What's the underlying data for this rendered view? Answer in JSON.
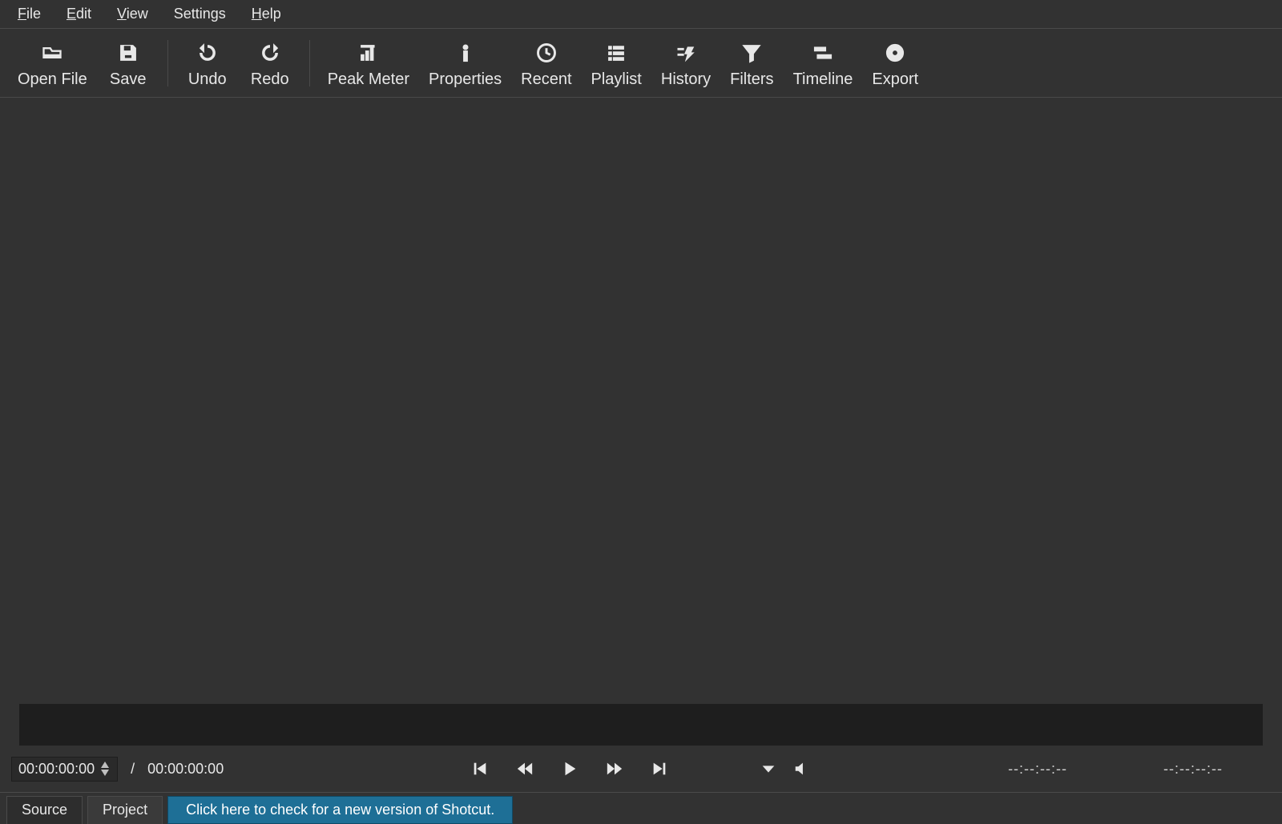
{
  "menubar": {
    "file": "File",
    "edit": "Edit",
    "view": "View",
    "settings": "Settings",
    "help": "Help"
  },
  "toolbar": {
    "open_file": "Open File",
    "save": "Save",
    "undo": "Undo",
    "redo": "Redo",
    "peak_meter": "Peak Meter",
    "properties": "Properties",
    "recent": "Recent",
    "playlist": "Playlist",
    "history": "History",
    "filters": "Filters",
    "timeline": "Timeline",
    "export": "Export"
  },
  "transport": {
    "current": "00:00:00:00",
    "duration": "00:00:00:00",
    "in_point": "--:--:--:--",
    "out_point": "--:--:--:--"
  },
  "tabs": {
    "source": "Source",
    "project": "Project"
  },
  "update_banner": "Click here to check for a new version of Shotcut."
}
